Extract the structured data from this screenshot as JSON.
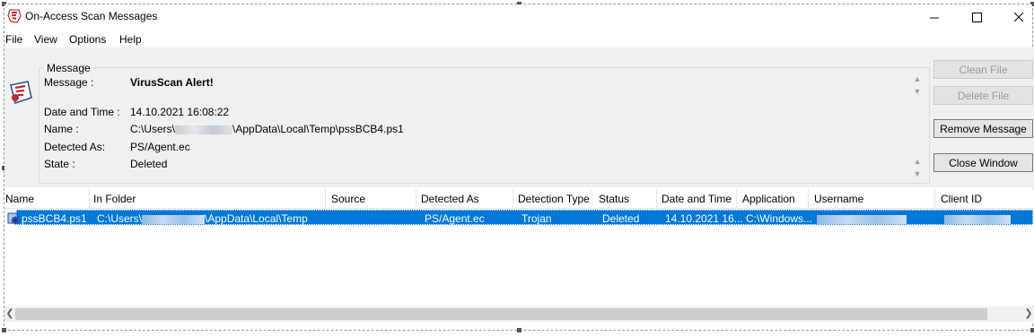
{
  "window": {
    "title": "On-Access Scan Messages",
    "controls": {
      "minimize": "minimize-icon",
      "maximize": "maximize-icon",
      "close": "close-icon"
    }
  },
  "menu": [
    "File",
    "View",
    "Options",
    "Help"
  ],
  "details": {
    "group_title": "Message",
    "fields": {
      "message": {
        "label": "Message :",
        "value": "VirusScan Alert!"
      },
      "date_time": {
        "label": "Date and Time :",
        "value": "14.10.2021 16:08:22"
      },
      "name": {
        "label": "Name :",
        "value_prefix": "C:\\Users\\",
        "value_suffix": "\\AppData\\Local\\Temp\\pssBCB4.ps1"
      },
      "detected_as": {
        "label": "Detected As:",
        "value": "PS/Agent.ec"
      },
      "state": {
        "label": "State :",
        "value": "Deleted"
      }
    }
  },
  "buttons": {
    "clean_file": "Clean File",
    "delete_file": "Delete File",
    "remove_message": "Remove Message",
    "close_window": "Close Window"
  },
  "list": {
    "columns": [
      "Name",
      "In Folder",
      "Source",
      "Detected As",
      "Detection Type",
      "Status",
      "Date and Time",
      "Application",
      "Username",
      "Client ID"
    ],
    "rows": [
      {
        "name": "pssBCB4.ps1",
        "folder_prefix": "C:\\Users\\",
        "folder_suffix": "\\AppData\\Local\\Temp",
        "source": "",
        "detected_as": "PS/Agent.ec",
        "detection_type": "Trojan",
        "status": "Deleted",
        "date_time": "14.10.2021 16...",
        "application": "C:\\Windows...",
        "username": "",
        "client_id": ""
      }
    ]
  },
  "colors": {
    "selection": "#0078d7",
    "panel": "#f0f0f0"
  }
}
